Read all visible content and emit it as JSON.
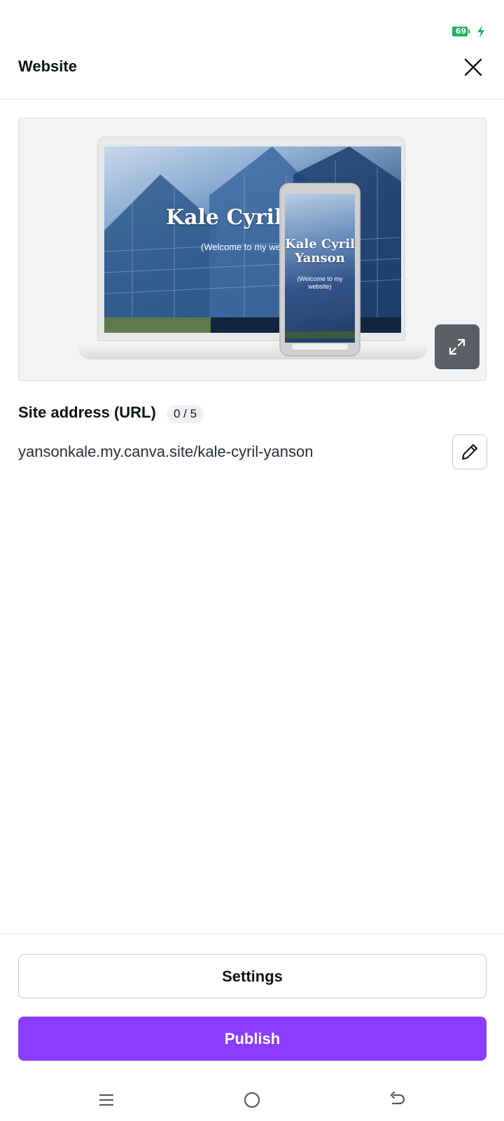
{
  "status_bar": {
    "battery_level": "69",
    "charging": true,
    "battery_color": "#21b35c"
  },
  "header": {
    "title": "Website",
    "close_icon": "close-icon"
  },
  "preview": {
    "site_title": "Kale Cyril Y",
    "site_subtitle": "(Welcome to my we",
    "mobile_title": "Kale Cyril Yanson",
    "mobile_subtitle": "(Welcome to my website)",
    "expand_icon": "expand-icon"
  },
  "site_address": {
    "label": "Site address (URL)",
    "count": "0 / 5",
    "url": "yansonkale.my.canva.site/kale-cyril-yanson",
    "edit_icon": "pencil-icon"
  },
  "actions": {
    "settings_label": "Settings",
    "publish_label": "Publish",
    "publish_color": "#8b3dff"
  },
  "nav": {
    "menu_icon": "menu-icon",
    "home_icon": "home-icon",
    "back_icon": "back-icon"
  }
}
